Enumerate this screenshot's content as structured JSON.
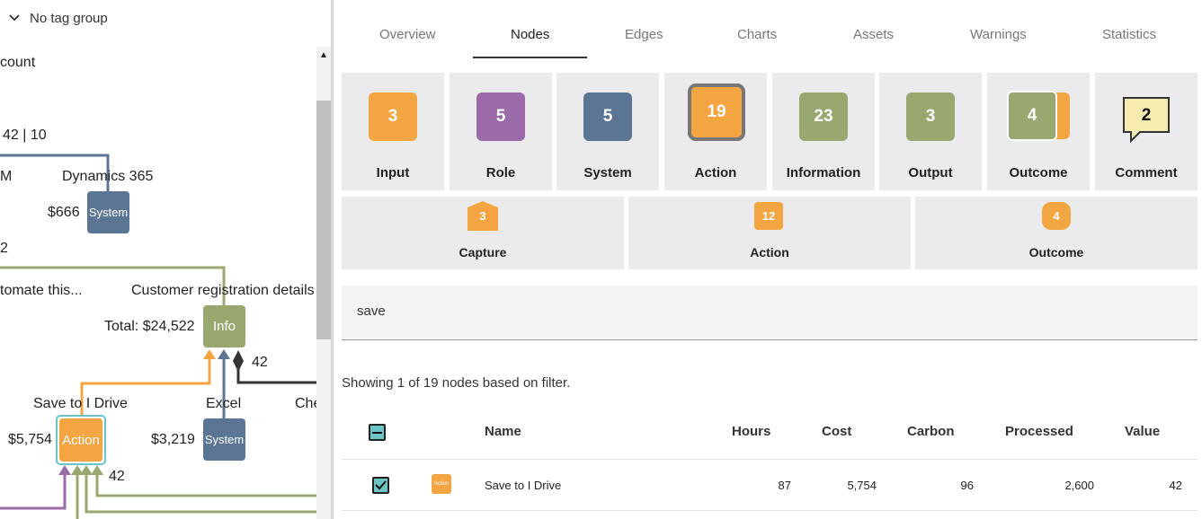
{
  "left_panel": {
    "tag_group_label": "No tag group",
    "canvas_texts": {
      "count": "count",
      "ratio": "42 | 10",
      "m": "M",
      "dynamics": "Dynamics 365",
      "cost_666": "$666",
      "two": "2",
      "automate": "tomate this...",
      "customer_reg": "Customer registration details",
      "total": "Total: $24,522",
      "num_42_a": "42",
      "save_to_drive": "Save to I Drive",
      "excel": "Excel",
      "che": "Che",
      "cost_5754": "$5,754",
      "cost_3219": "$3,219",
      "num_42_b": "42"
    },
    "nodes": {
      "system_top": "System",
      "info": "Info",
      "action": "Action",
      "system_bottom": "System"
    }
  },
  "tabs": [
    "Overview",
    "Nodes",
    "Edges",
    "Charts",
    "Assets",
    "Warnings",
    "Statistics"
  ],
  "active_tab": "Nodes",
  "cards": [
    {
      "label": "Input",
      "count": "3",
      "color": "#f2a541"
    },
    {
      "label": "Role",
      "count": "5",
      "color": "#9b6aa8"
    },
    {
      "label": "System",
      "count": "5",
      "color": "#5b7694"
    },
    {
      "label": "Action",
      "count": "19",
      "color": "#f2a541"
    },
    {
      "label": "Information",
      "count": "23",
      "color": "#98a86e"
    },
    {
      "label": "Output",
      "count": "3",
      "color": "#98a86e"
    },
    {
      "label": "Outcome",
      "count": "4",
      "color": "#98a86e"
    },
    {
      "label": "Comment",
      "count": "2",
      "color": "#f7ecb0"
    }
  ],
  "sub_cards": [
    {
      "label": "Capture",
      "count": "3",
      "color": "#f2a541"
    },
    {
      "label": "Action",
      "count": "12",
      "color": "#f2a541"
    },
    {
      "label": "Outcome",
      "count": "4",
      "color": "#f2a541"
    }
  ],
  "search": {
    "value": "save"
  },
  "filter_summary": "Showing 1 of 19 nodes based on filter.",
  "table": {
    "headers": {
      "name": "Name",
      "hours": "Hours",
      "cost": "Cost",
      "carbon": "Carbon",
      "processed": "Processed",
      "value": "Value"
    },
    "rows": [
      {
        "type_icon": "Action",
        "name": "Save to I Drive",
        "hours": "87",
        "cost": "5,754",
        "carbon": "96",
        "processed": "2,600",
        "value": "42"
      }
    ]
  }
}
